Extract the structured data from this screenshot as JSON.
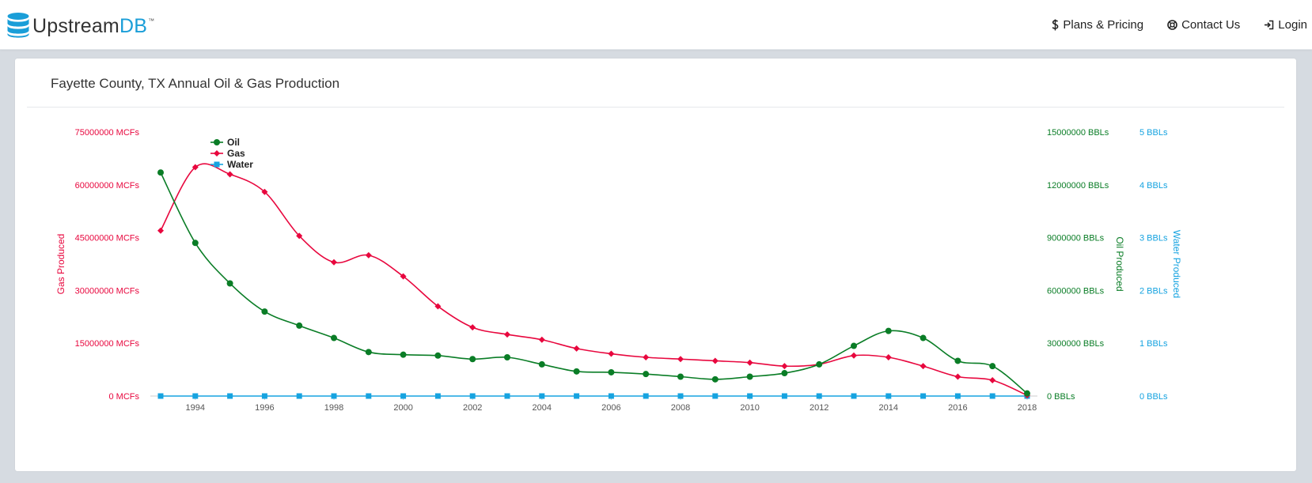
{
  "brand": {
    "name_part1": "Upstream",
    "name_part2": "DB",
    "tm": "™",
    "logo_icon": "database-icon"
  },
  "nav": {
    "items": [
      {
        "label": "Plans & Pricing",
        "icon": "dollar-icon"
      },
      {
        "label": "Contact Us",
        "icon": "life-ring-icon"
      },
      {
        "label": "Login",
        "icon": "sign-in-icon"
      }
    ]
  },
  "card": {
    "title": "Fayette County, TX Annual Oil & Gas Production"
  },
  "colors": {
    "gas": "#e8073e",
    "oil": "#0a7d26",
    "water": "#16a3e0",
    "brand_blue": "#1a9ed8"
  },
  "chart_data": {
    "type": "line",
    "x": [
      1993,
      1994,
      1995,
      1996,
      1997,
      1998,
      1999,
      2000,
      2001,
      2002,
      2003,
      2004,
      2005,
      2006,
      2007,
      2008,
      2009,
      2010,
      2011,
      2012,
      2013,
      2014,
      2015,
      2016,
      2017,
      2018
    ],
    "x_tick_labels": [
      "1994",
      "1996",
      "1998",
      "2000",
      "2002",
      "2004",
      "2006",
      "2008",
      "2010",
      "2012",
      "2014",
      "2016",
      "2018"
    ],
    "series": [
      {
        "name": "Oil",
        "axis": "Oil Produced",
        "marker": "circle",
        "values": [
          12700000,
          8700000,
          6400000,
          4800000,
          4000000,
          3300000,
          2500000,
          2350000,
          2300000,
          2100000,
          2200000,
          1800000,
          1400000,
          1350000,
          1250000,
          1100000,
          950000,
          1100000,
          1300000,
          1800000,
          2850000,
          3700000,
          3300000,
          2000000,
          1700000,
          150000
        ]
      },
      {
        "name": "Gas",
        "axis": "Gas Produced",
        "marker": "diamond",
        "values": [
          47000000,
          65000000,
          63000000,
          58000000,
          45500000,
          38000000,
          40000000,
          34000000,
          25500000,
          19500000,
          17500000,
          16000000,
          13500000,
          12000000,
          11000000,
          10500000,
          10000000,
          9500000,
          8500000,
          9000000,
          11500000,
          11000000,
          8500000,
          5500000,
          4500000,
          200000
        ]
      },
      {
        "name": "Water",
        "axis": "Water Produced",
        "marker": "square",
        "values": [
          0,
          0,
          0,
          0,
          0,
          0,
          0,
          0,
          0,
          0,
          0,
          0,
          0,
          0,
          0,
          0,
          0,
          0,
          0,
          0,
          0,
          0,
          0,
          0,
          0,
          0
        ]
      }
    ],
    "axes": {
      "gas": {
        "label": "Gas Produced",
        "range": [
          0,
          75000000
        ],
        "ticks": [
          "0 MCFs",
          "15000000 MCFs",
          "30000000 MCFs",
          "45000000 MCFs",
          "60000000 MCFs",
          "75000000 MCFs"
        ]
      },
      "oil": {
        "label": "Oil Produced",
        "range": [
          0,
          15000000
        ],
        "ticks": [
          "0 BBLs",
          "3000000 BBLs",
          "6000000 BBLs",
          "9000000 BBLs",
          "12000000 BBLs",
          "15000000 BBLs"
        ]
      },
      "water": {
        "label": "Water Produced",
        "range": [
          0,
          5
        ],
        "ticks": [
          "0 BBLs",
          "1 BBLs",
          "2 BBLs",
          "3 BBLs",
          "4 BBLs",
          "5 BBLs"
        ]
      }
    },
    "legend_position": "top-left",
    "grid": false
  }
}
